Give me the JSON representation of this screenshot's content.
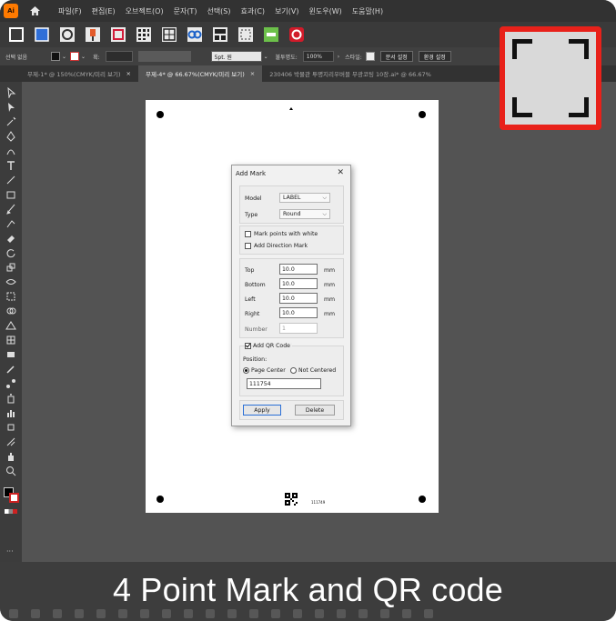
{
  "menu": {
    "items": [
      "파일(F)",
      "편집(E)",
      "오브젝트(O)",
      "문자(T)",
      "선택(S)",
      "효과(C)",
      "보기(V)",
      "윈도우(W)",
      "도움말(H)"
    ]
  },
  "controlbar": {
    "selection_label": "선택 없음",
    "stroke_label": "획:",
    "brush_label": "5pt. 원",
    "opacity_label": "불투명도:",
    "opacity_value": "100%",
    "style_label": "스타일:",
    "doc_setup_button": "문서 설정",
    "prefs_button": "환경 설정"
  },
  "tabs": [
    {
      "label": "무제-1* @ 150%(CMYK/미리 보기)",
      "close": "×",
      "active": false
    },
    {
      "label": "무제-4* @ 66.67%(CMYK/미리 보기)",
      "close": "×",
      "active": true
    },
    {
      "label": "230406 박물관 투명지리우버블 무광코팅 10장.ai* @ 66.67%",
      "close": "",
      "active": false
    }
  ],
  "colors": {
    "accent_red": "#e8211a",
    "primary_button_border": "#2a6fd6",
    "icon_orange": "#ff7a00"
  },
  "dialog": {
    "title": "Add Mark",
    "close": "✕",
    "model_label": "Model",
    "model_value": "LABEL",
    "type_label": "Type",
    "type_value": "Round",
    "mark_white_label": "Mark points with white",
    "mark_white_checked": false,
    "direction_label": "Add Direction Mark",
    "direction_checked": false,
    "top_label": "Top",
    "top_value": "10.0",
    "bottom_label": "Bottom",
    "bottom_value": "10.0",
    "left_label": "Left",
    "left_value": "10.0",
    "right_label": "Right",
    "right_value": "10.0",
    "unit": "mm",
    "number_label": "Number",
    "number_value": "1",
    "qr_label": "Add QR Code",
    "qr_checked": true,
    "position_label": "Position:",
    "page_center_label": "Page Center",
    "not_centered_label": "Not Centered",
    "qr_value": "111754",
    "apply_label": "Apply",
    "delete_label": "Delete"
  },
  "artboard": {
    "qr_caption": "111749"
  },
  "caption": "4 Point Mark and QR code"
}
